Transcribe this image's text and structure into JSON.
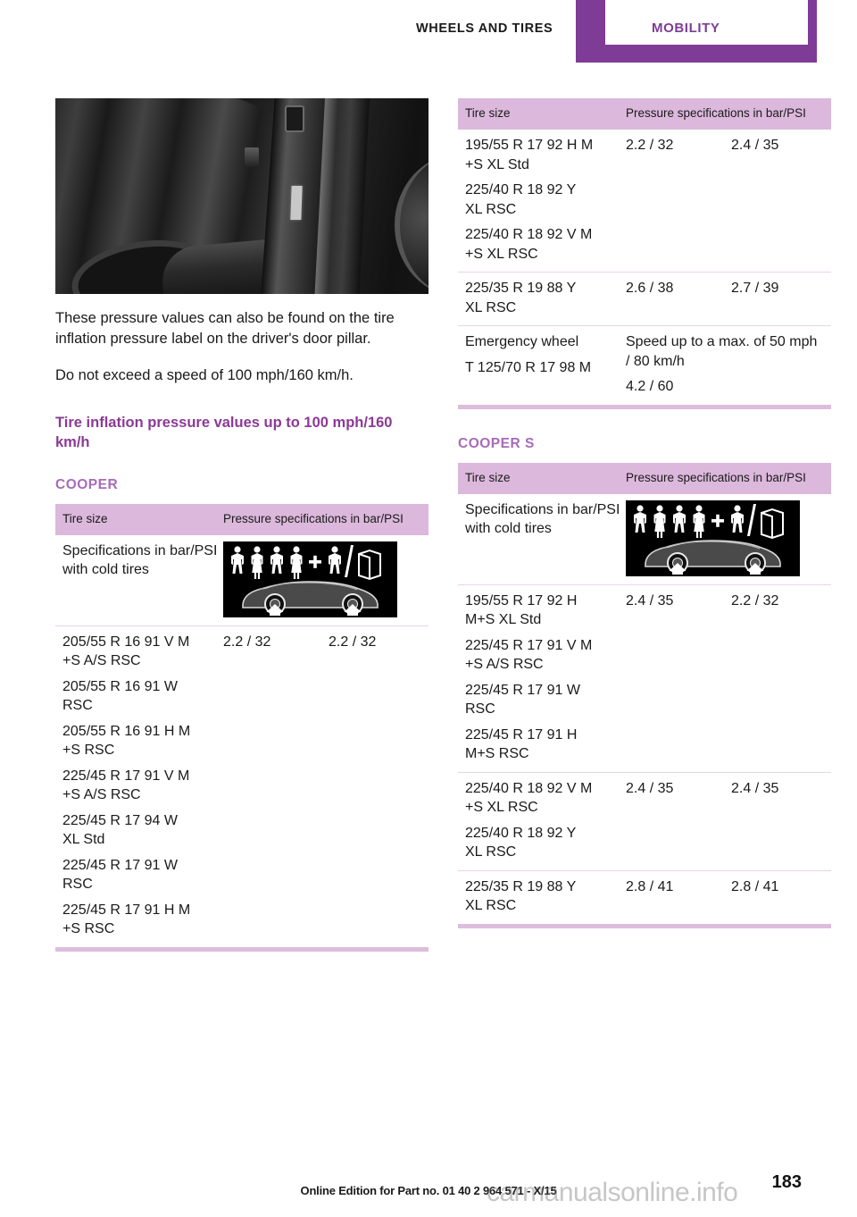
{
  "header": {
    "chapter": "WHEELS AND TIRES",
    "section": "MOBILITY"
  },
  "left_column": {
    "photo_alt": "car-door-pillar-tire-label-photo",
    "paragraphs": [
      "These pressure values can also be found on the tire inflation pressure label on the driver's door pillar.",
      "Do not exceed a speed of 100 mph/160 km/h."
    ],
    "heading": "Tire inflation pressure values up to 100 mph/160 km/h",
    "model_heading": "COOPER",
    "table": {
      "col_size": "Tire size",
      "col_pressure": "Pressure specifications in bar/PSI",
      "spec_row_label": "Specifications in bar/PSI with cold tires",
      "rows": [
        {
          "sizes": [
            [
              "205/55 R 16 91 V M",
              "+S A/S RSC"
            ],
            [
              "205/55 R 16 91 W",
              "RSC"
            ],
            [
              "205/55 R 16 91 H M",
              "+S RSC"
            ],
            [
              "225/45 R 17 91 V M",
              "+S A/S RSC"
            ],
            [
              "225/45 R 17 94 W",
              "XL Std"
            ],
            [
              "225/45 R 17 91 W",
              "RSC"
            ],
            [
              "225/45 R 17 91 H M",
              "+S RSC"
            ]
          ],
          "v1": "2.2 / 32",
          "v2": "2.2 / 32"
        }
      ]
    }
  },
  "right_column": {
    "table_cooper_cont": {
      "col_size": "Tire size",
      "col_pressure": "Pressure specifications in bar/PSI",
      "rows": [
        {
          "sizes": [
            [
              "195/55 R 17 92 H M",
              "+S XL Std"
            ],
            [
              "225/40 R 18 92 Y",
              "XL RSC"
            ],
            [
              "225/40 R 18 92 V M",
              "+S XL RSC"
            ]
          ],
          "v1": "2.2 / 32",
          "v2": "2.4 / 35"
        },
        {
          "sizes": [
            [
              "225/35 R 19 88 Y",
              "XL RSC"
            ]
          ],
          "v1": "2.6 / 38",
          "v2": "2.7 / 39"
        }
      ],
      "emergency": {
        "label_line1": "Emergency wheel",
        "label_line2": "T 125/70 R 17 98 M",
        "value_line1": "Speed up to a max. of 50 mph / 80 km/h",
        "value_line2": "4.2 / 60"
      }
    },
    "model_heading": "COOPER S",
    "table_cooper_s": {
      "col_size": "Tire size",
      "col_pressure": "Pressure specifications in bar/PSI",
      "spec_row_label": "Specifications in bar/PSI with cold tires",
      "rows": [
        {
          "sizes": [
            [
              "195/55 R 17 92 H",
              "M+S XL Std"
            ],
            [
              "225/45 R 17 91 V M",
              "+S A/S RSC"
            ],
            [
              "225/45 R 17 91 W",
              "RSC"
            ],
            [
              "225/45 R 17 91 H",
              "M+S RSC"
            ]
          ],
          "v1": "2.4 / 35",
          "v2": "2.2 / 32"
        },
        {
          "sizes": [
            [
              "225/40 R 18 92 V M",
              "+S XL RSC"
            ],
            [
              "225/40 R 18 92 Y",
              "XL RSC"
            ]
          ],
          "v1": "2.4 / 35",
          "v2": "2.4 / 35"
        },
        {
          "sizes": [
            [
              "225/35 R 19 88 Y",
              "XL RSC"
            ]
          ],
          "v1": "2.8 / 41",
          "v2": "2.8 / 41"
        }
      ]
    }
  },
  "footer": {
    "edition": "Online Edition for Part no. 01 40 2 964 571 - X/15",
    "page_number": "183",
    "watermark": "carmanualsonline.info"
  },
  "colors": {
    "brand_purple": "#7E3C96",
    "heading_purple": "#8B3A96",
    "subheading_purple": "#A86BB8",
    "table_header_bg": "#DCB8DC",
    "rule_light": "#E8D5E8",
    "rule_thick": "#DCBDDC"
  }
}
